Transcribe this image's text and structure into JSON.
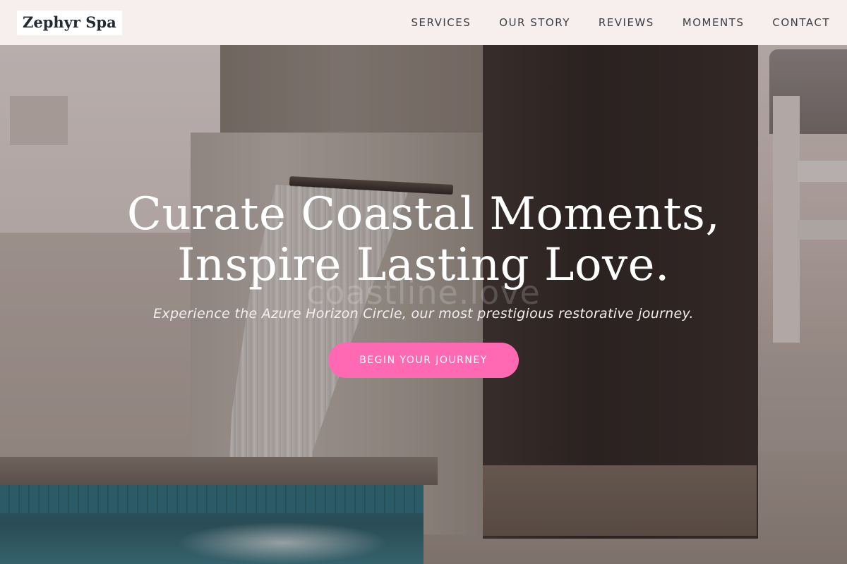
{
  "header": {
    "logo": "Zephyr Spa",
    "nav": [
      {
        "label": "SERVICES"
      },
      {
        "label": "OUR STORY"
      },
      {
        "label": "REVIEWS"
      },
      {
        "label": "MOMENTS"
      },
      {
        "label": "CONTACT"
      }
    ]
  },
  "hero": {
    "title_line1": "Curate Coastal Moments,",
    "title_line2": "Inspire Lasting Love.",
    "subtitle": "Experience the Azure Horizon Circle, our most prestigious restorative journey.",
    "cta_label": "BEGIN YOUR JOURNEY",
    "watermark": "coastline.love"
  },
  "colors": {
    "header_bg": "#f7eeee",
    "accent": "#ff69b4",
    "logo_text": "#222a33"
  },
  "icons": []
}
